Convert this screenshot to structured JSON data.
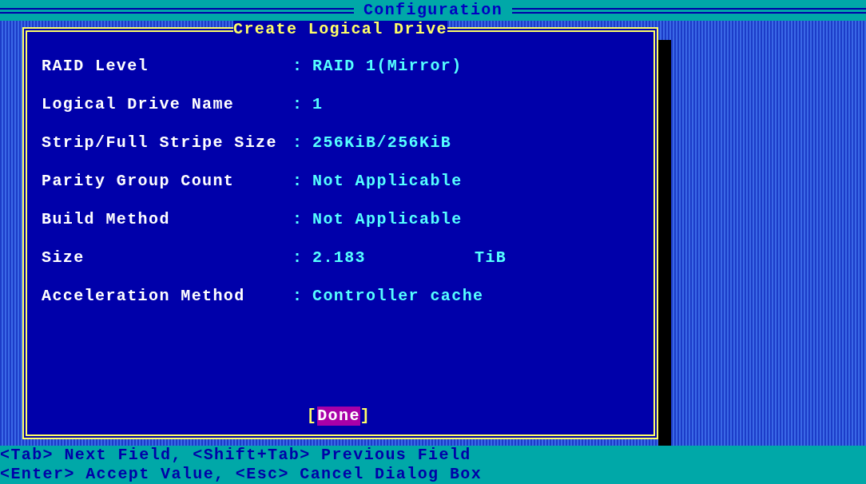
{
  "header": {
    "title": "Configuration"
  },
  "dialog": {
    "title": "Create Logical Drive",
    "fields": [
      {
        "label": "RAID Level",
        "separator": ":",
        "value": "RAID 1(Mirror)"
      },
      {
        "label": "Logical Drive Name",
        "separator": ":",
        "value": "1"
      },
      {
        "label": "Strip/Full Stripe Size",
        "separator": ":",
        "value": "256KiB/256KiB"
      },
      {
        "label": "Parity Group Count",
        "separator": ":",
        "value": "Not Applicable"
      },
      {
        "label": "Build Method",
        "separator": ":",
        "value": "Not Applicable"
      },
      {
        "label": "Size",
        "separator": ":",
        "value": "2.183",
        "unit": "TiB"
      },
      {
        "label": "Acceleration Method",
        "separator": ":",
        "value": "Controller cache"
      }
    ],
    "button": {
      "left": "[",
      "label": "Done",
      "right": "]",
      "focused": true
    }
  },
  "help": [
    "<Tab> Next Field, <Shift+Tab> Previous Field",
    "<Enter> Accept Value, <Esc> Cancel Dialog Box"
  ]
}
